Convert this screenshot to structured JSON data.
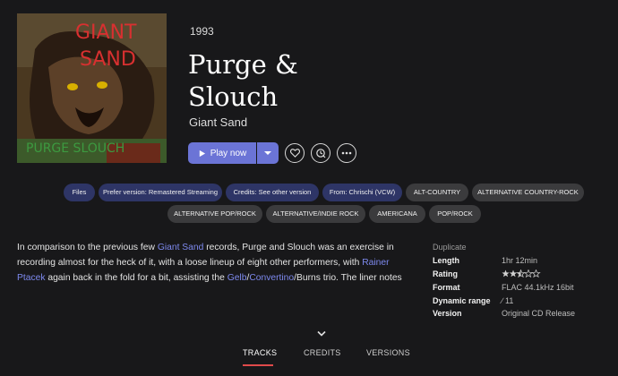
{
  "album": {
    "year": "1993",
    "title_line1": "Purge &",
    "title_line2": "Slouch",
    "artist": "Giant Sand",
    "cover_text_top1": "GIANT",
    "cover_text_top2": "SAND",
    "cover_text_bottom": "PURGE SLOUCH"
  },
  "actions": {
    "play_label": "Play now",
    "icons": [
      "play-icon",
      "caret-down-icon",
      "heart-icon",
      "radio-icon",
      "more-icon"
    ]
  },
  "tags": [
    {
      "label": "Files",
      "kind": "blue"
    },
    {
      "label": "Prefer version: Remastered Streaming",
      "kind": "blue"
    },
    {
      "label": "Credits: See other version",
      "kind": "blue"
    },
    {
      "label": "From: Chrischi (VCW)",
      "kind": "blue"
    },
    {
      "label": "ALT-COUNTRY",
      "kind": "grey"
    },
    {
      "label": "ALTERNATIVE COUNTRY-ROCK",
      "kind": "grey"
    },
    {
      "label": "ALTERNATIVE POP/ROCK",
      "kind": "grey"
    },
    {
      "label": "ALTERNATIVE/INDIE ROCK",
      "kind": "grey"
    },
    {
      "label": "AMERICANA",
      "kind": "grey"
    },
    {
      "label": "POP/ROCK",
      "kind": "grey"
    }
  ],
  "description": {
    "p1": "In comparison to the previous few ",
    "link1": "Giant Sand",
    "p2": " records, Purge and Slouch was an exercise in recording almost for the heck of it, with a loose lineup of eight other performers, with ",
    "link2": "Rainer Ptacek",
    "p3": " again back in the fold for a bit, assisting the ",
    "link3": "Gelb",
    "p4": "/",
    "link4": "Convertino",
    "p5": "/Burns trio. The liner notes"
  },
  "metadata": {
    "heading": "Duplicate",
    "rows": [
      {
        "key": "Length",
        "value": "1hr 12min"
      },
      {
        "key": "Rating",
        "value": "",
        "stars": 2.5
      },
      {
        "key": "Format",
        "value": "FLAC 44.1kHz 16bit"
      },
      {
        "key": "Dynamic range",
        "value": "∕ 11"
      },
      {
        "key": "Version",
        "value": "Original CD Release"
      }
    ]
  },
  "tabs": [
    {
      "label": "TRACKS",
      "active": true
    },
    {
      "label": "CREDITS",
      "active": false
    },
    {
      "label": "VERSIONS",
      "active": false
    }
  ],
  "colors": {
    "accent": "#6b74d6",
    "link": "#7d89ee",
    "tab_underline": "#e04a4a"
  }
}
